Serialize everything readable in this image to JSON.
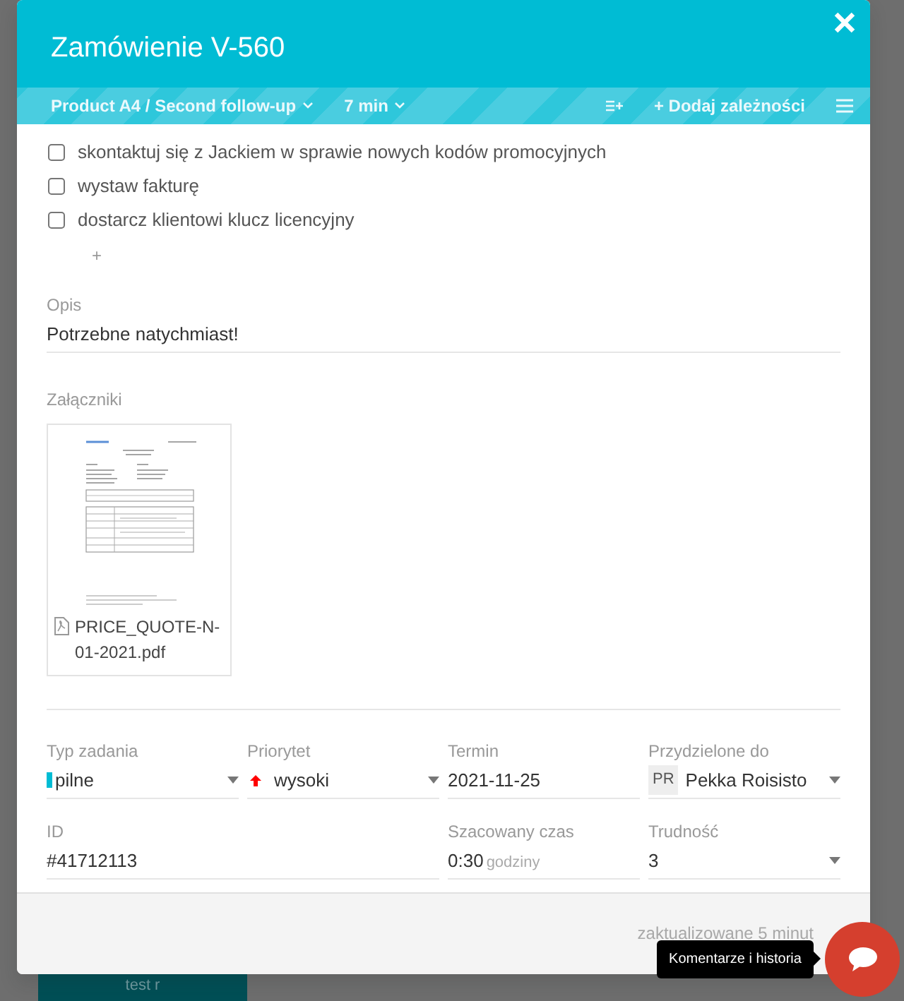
{
  "backdrop": {
    "card_text": "test r"
  },
  "dialog": {
    "title": "Zamówienie V-560",
    "toolbar": {
      "project": "Product A4 / Second follow-up",
      "time": "7 min",
      "add_dependency": "+ Dodaj zależności"
    },
    "checklist": [
      {
        "text": "skontaktuj się z Jackiem w sprawie nowych kodów promocyjnych",
        "checked": false
      },
      {
        "text": "wystaw fakturę",
        "checked": false
      },
      {
        "text": "dostarcz klientowi klucz licencyjny",
        "checked": false
      }
    ],
    "add_item": "+",
    "description": {
      "label": "Opis",
      "value": "Potrzebne natychmiast!"
    },
    "attachments": {
      "label": "Załączniki",
      "files": [
        {
          "name": "PRICE_QUOTE-N-01-2021.pdf"
        }
      ]
    },
    "fields": [
      {
        "kind": "tag",
        "label": "Typ zadania",
        "value": "pilne",
        "color": "#00bcd4"
      },
      {
        "kind": "priority",
        "label": "Priorytet",
        "value": "wysoki",
        "color": "#ff0000"
      },
      {
        "kind": "date",
        "label": "Termin",
        "value": "2021-11-25"
      },
      {
        "kind": "user",
        "label": "Przydzielone do",
        "value": "Pekka Roisisto",
        "initials": "PR"
      },
      {
        "kind": "id",
        "label": "ID",
        "value": "#41712113"
      },
      {
        "kind": "duration",
        "label": "Szacowany czas",
        "value": "0:30",
        "unit": "godziny"
      },
      {
        "kind": "select",
        "label": "Trudność",
        "value": "3"
      }
    ],
    "footer": {
      "updated": "zaktualizowane 5 minut"
    }
  },
  "chat": {
    "tooltip": "Komentarze i historia"
  }
}
